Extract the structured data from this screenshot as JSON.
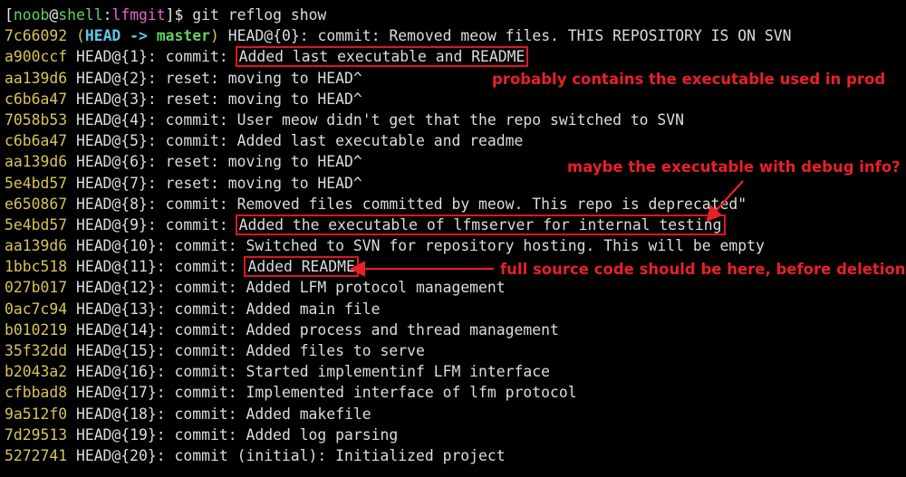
{
  "prompt": {
    "open_bracket": "[",
    "user": "noob",
    "at": "@",
    "host": "shell",
    "colon": ":",
    "path": "lfmgit",
    "close": "]$ ",
    "command": "git reflog show"
  },
  "entries": [
    {
      "hash": "7c66092",
      "ref": "HEAD@{0}",
      "action": "commit",
      "message": "Removed meow files. THIS REPOSITORY IS ON SVN",
      "decoration": {
        "open": "(",
        "head": "HEAD",
        "arrow": " -> ",
        "branch": "master",
        "close": ")"
      }
    },
    {
      "hash": "a900ccf",
      "ref": "HEAD@{1}",
      "action": "commit",
      "message": "Added last executable and README",
      "highlighted": true
    },
    {
      "hash": "aa139d6",
      "ref": "HEAD@{2}",
      "action": "reset",
      "message": "moving to HEAD^"
    },
    {
      "hash": "c6b6a47",
      "ref": "HEAD@{3}",
      "action": "reset",
      "message": "moving to HEAD^"
    },
    {
      "hash": "7058b53",
      "ref": "HEAD@{4}",
      "action": "commit",
      "message": "User meow didn't get that the repo switched to SVN"
    },
    {
      "hash": "c6b6a47",
      "ref": "HEAD@{5}",
      "action": "commit",
      "message": "Added last executable and readme"
    },
    {
      "hash": "aa139d6",
      "ref": "HEAD@{6}",
      "action": "reset",
      "message": "moving to HEAD^"
    },
    {
      "hash": "5e4bd57",
      "ref": "HEAD@{7}",
      "action": "reset",
      "message": "moving to HEAD^"
    },
    {
      "hash": "e650867",
      "ref": "HEAD@{8}",
      "action": "commit",
      "message": "Removed files committed by meow. This repo is deprecated\""
    },
    {
      "hash": "5e4bd57",
      "ref": "HEAD@{9}",
      "action": "commit",
      "message": "Added the executable of lfmserver for internal testing",
      "highlighted": true
    },
    {
      "hash": "aa139d6",
      "ref": "HEAD@{10}",
      "action": "commit",
      "message": "Switched to SVN for repository hosting. This will be empty"
    },
    {
      "hash": "1bbc518",
      "ref": "HEAD@{11}",
      "action": "commit",
      "message": "Added README",
      "highlighted": true
    },
    {
      "hash": "027b017",
      "ref": "HEAD@{12}",
      "action": "commit",
      "message": "Added LFM protocol management"
    },
    {
      "hash": "0ac7c94",
      "ref": "HEAD@{13}",
      "action": "commit",
      "message": "Added main file"
    },
    {
      "hash": "b010219",
      "ref": "HEAD@{14}",
      "action": "commit",
      "message": "Added process and thread management"
    },
    {
      "hash": "35f32dd",
      "ref": "HEAD@{15}",
      "action": "commit",
      "message": "Added files to serve"
    },
    {
      "hash": "b2043a2",
      "ref": "HEAD@{16}",
      "action": "commit",
      "message": "Started implementinf LFM interface"
    },
    {
      "hash": "cfbbad8",
      "ref": "HEAD@{17}",
      "action": "commit",
      "message": "Implemented interface of lfm protocol"
    },
    {
      "hash": "9a512f0",
      "ref": "HEAD@{18}",
      "action": "commit",
      "message": "Added makefile"
    },
    {
      "hash": "7d29513",
      "ref": "HEAD@{19}",
      "action": "commit",
      "message": "Added log parsing"
    },
    {
      "hash": "5272741",
      "ref": "HEAD@{20}",
      "action": "commit (initial)",
      "message": "Initialized project"
    }
  ],
  "annotations": {
    "prod": "probably contains the executable used in prod",
    "debug": "maybe the executable with debug info?",
    "source": "full source code should be here, before deletion"
  },
  "colors": {
    "background": "#000000",
    "text": "#dcdcdc",
    "hash": "#d8c35a",
    "user_host": "#62d15f",
    "path": "#e066cf",
    "head_ref": "#62c8e8",
    "annotation": "#e8202a"
  }
}
